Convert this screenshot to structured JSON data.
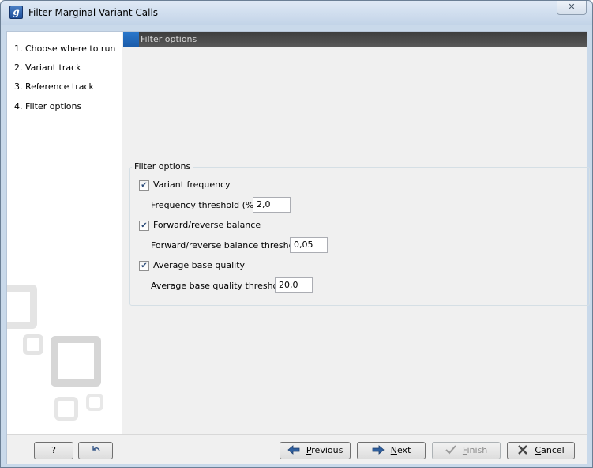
{
  "window": {
    "title": "Filter Marginal Variant Calls",
    "app_icon_letter": "g",
    "close_glyph": "✕"
  },
  "steps": [
    {
      "label": "1.  Choose where to run"
    },
    {
      "label": "2.  Variant track"
    },
    {
      "label": "3.  Reference track"
    },
    {
      "label": "4.  Filter options"
    }
  ],
  "panel": {
    "header_title": "Filter options",
    "group_title": "Filter options",
    "options": {
      "variant_frequency": {
        "label": "Variant frequency",
        "checked": true
      },
      "frequency_threshold": {
        "label": "Frequency threshold (%)",
        "value": "2,0"
      },
      "fr_balance": {
        "label": "Forward/reverse balance",
        "checked": true
      },
      "fr_balance_threshold": {
        "label": "Forward/reverse balance threshold",
        "value": "0,05"
      },
      "avg_base_quality": {
        "label": "Average base quality",
        "checked": true
      },
      "avg_base_quality_threshold": {
        "label": "Average base quality threshold",
        "value": "20,0"
      }
    }
  },
  "footer": {
    "help_label": "?",
    "reset_icon": "undo-icon",
    "previous": {
      "first": "P",
      "rest": "revious"
    },
    "next": {
      "first": "N",
      "rest": "ext"
    },
    "finish": {
      "first": "F",
      "rest": "inish"
    },
    "cancel": {
      "first": "C",
      "rest": "ancel"
    }
  },
  "colors": {
    "header_bar": "#4a4a4a",
    "header_accent": "#1f64b8",
    "watermark": "#d9d9d9"
  }
}
